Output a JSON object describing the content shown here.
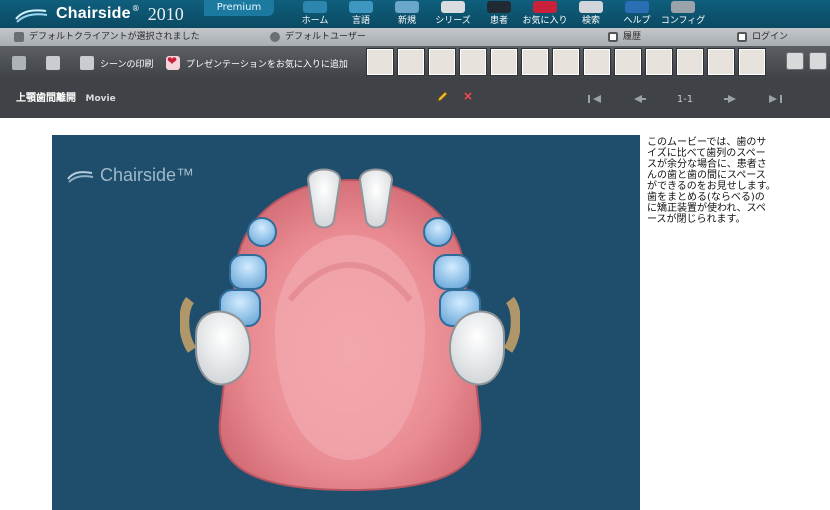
{
  "app": {
    "brand": "Chairside",
    "brand_mark": "®",
    "year": "2010",
    "edition": "Premium"
  },
  "nav": {
    "items": [
      {
        "label": "ホーム",
        "icon": "home-icon"
      },
      {
        "label": "言語",
        "icon": "language-icon"
      },
      {
        "label": "新規",
        "icon": "new-icon"
      },
      {
        "label": "シリーズ",
        "icon": "series-icon"
      },
      {
        "label": "患者",
        "icon": "patient-icon"
      },
      {
        "label": "お気に入り",
        "icon": "favorite-icon"
      },
      {
        "label": "検索",
        "icon": "search-icon"
      },
      {
        "label": "ヘルプ",
        "icon": "help-icon"
      },
      {
        "label": "コンフィグ",
        "icon": "config-icon"
      }
    ]
  },
  "status": {
    "client_text": "デフォルトクライアントが選択されました",
    "user_text": "デフォルトユーザー",
    "history_label": "履歴",
    "login_label": "ログイン"
  },
  "toolbar": {
    "print_scene": "シーンの印刷",
    "add_presentation": "プレゼンテーションをお気に入りに追加"
  },
  "title": {
    "main": "上顎歯間離開",
    "type": "Movie",
    "page": "1-1"
  },
  "description": {
    "text": "このムービーでは、歯のサイズに比べて歯列のスペースが余分な場合に、患者さんの歯と歯の間にスペースができるのをお見せします。　歯をまとめる(ならべる)のに矯正装置が使われ、スペースが閉じられます。"
  },
  "video": {
    "watermark": "Chairside™"
  },
  "colors": {
    "topbar": "#0f5f7d",
    "toolbar": "#444a4f",
    "video_bg": "#1f4d6c"
  }
}
